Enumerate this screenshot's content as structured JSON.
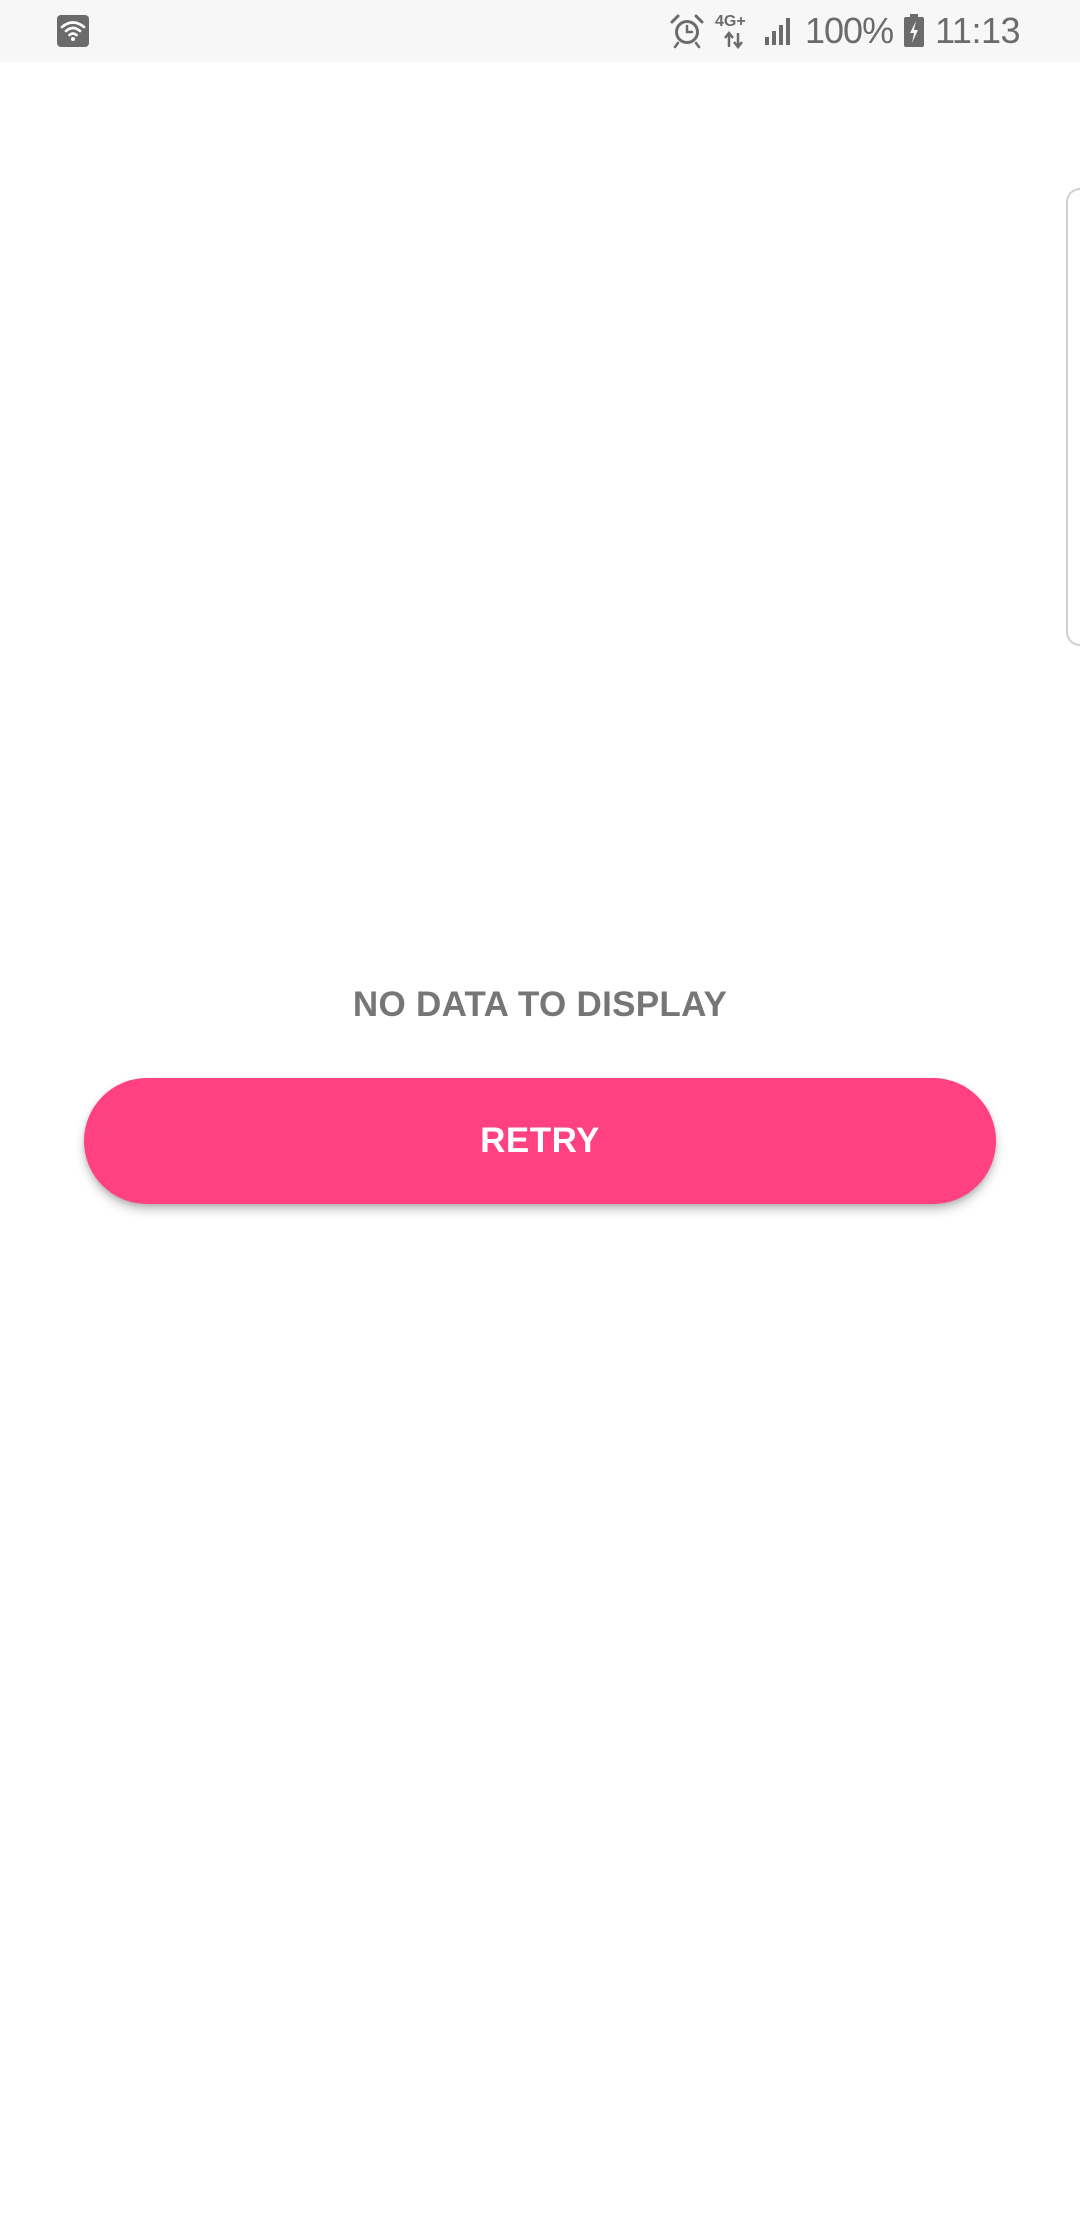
{
  "status_bar": {
    "battery_percent": "100%",
    "time": "11:13",
    "network_type": "4G+",
    "icons": [
      "wifi-icon",
      "alarm-icon",
      "data-arrows-icon",
      "signal-icon",
      "battery-charging-icon"
    ]
  },
  "main": {
    "empty_message": "NO DATA TO DISPLAY",
    "retry_label": "RETRY"
  },
  "colors": {
    "accent": "#ff4081",
    "text_secondary": "#767676",
    "status_bar_bg": "#f7f7f7",
    "background": "#ffffff"
  }
}
